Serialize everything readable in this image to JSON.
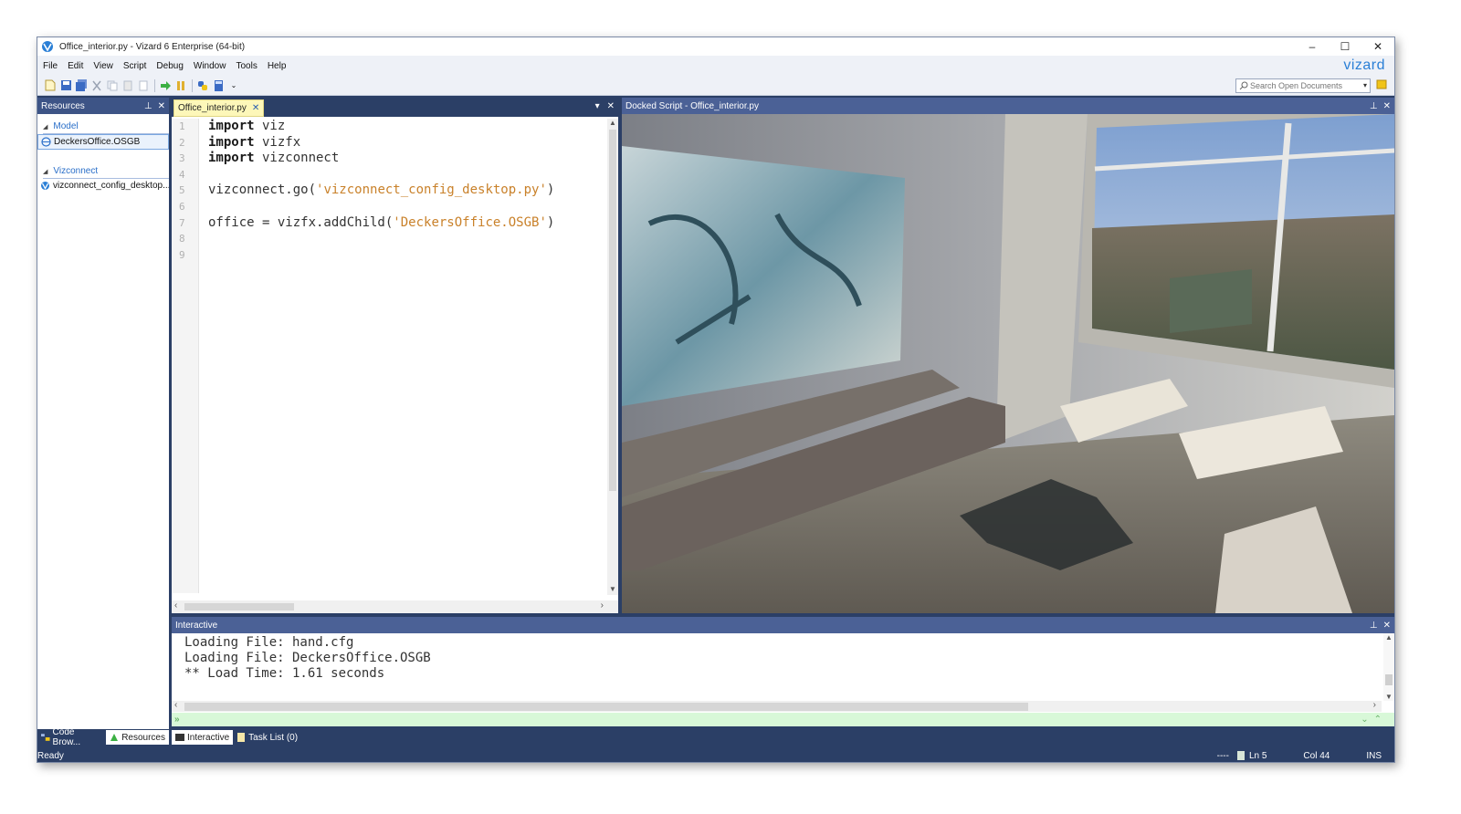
{
  "window": {
    "title": "Office_interior.py - Vizard 6 Enterprise (64-bit)",
    "controls": [
      "–",
      "☐",
      "✕"
    ]
  },
  "menu": [
    "File",
    "Edit",
    "View",
    "Script",
    "Debug",
    "Window",
    "Tools",
    "Help"
  ],
  "brand": "vizard",
  "search": {
    "placeholder": "Search Open Documents"
  },
  "resources": {
    "title": "Resources",
    "groups": [
      {
        "label": "Model",
        "items": [
          "DeckersOffice.OSGB"
        ]
      },
      {
        "label": "Vizconnect",
        "items": [
          "vizconnect_config_desktop...."
        ]
      }
    ]
  },
  "editor": {
    "tab_label": "Office_interior.py",
    "line_numbers": [
      "1",
      "2",
      "3",
      "4",
      "5",
      "6",
      "7",
      "8",
      "9"
    ]
  },
  "code": {
    "l1_kw": "import",
    "l1_rest": " viz",
    "l2_kw": "import",
    "l2_rest": " vizfx",
    "l3_kw": "import",
    "l3_rest": " vizconnect",
    "l5_a": "vizconnect.go(",
    "l5_str": "'vizconnect_config_desktop.py'",
    "l5_b": ")",
    "l7_a": "office = vizfx.addChild(",
    "l7_str": "'DeckersOffice.OSGB'",
    "l7_b": ")"
  },
  "docked": {
    "title": "Docked Script - Office_interior.py"
  },
  "interactive": {
    "title": "Interactive",
    "lines": [
      "Loading File: hand.cfg",
      "Loading File: DeckersOffice.OSGB",
      "** Load Time: 1.61 seconds"
    ],
    "prompt": "»"
  },
  "bottom_tabs_left": [
    "Code Brow...",
    "Resources"
  ],
  "bottom_tabs_main": [
    "Interactive",
    "Task List (0)"
  ],
  "status": {
    "ready": "Ready",
    "dashes": "----",
    "line": "Ln 5",
    "col": "Col 44",
    "mode": "INS"
  },
  "colors": {
    "frame": "#2b3f66",
    "panel_header": "#4b6196",
    "tab_active": "#fdf7b9",
    "prompt_bg": "#d8f8d8",
    "string": "#c9812a",
    "brand": "#2a7fd6"
  }
}
